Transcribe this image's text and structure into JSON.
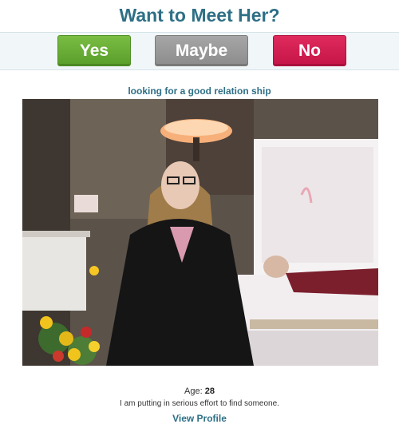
{
  "header": {
    "title": "Want to Meet Her?"
  },
  "actions": {
    "yes_label": "Yes",
    "maybe_label": "Maybe",
    "no_label": "No"
  },
  "profile": {
    "tagline": "looking for a good relation ship",
    "age_label": "Age:",
    "age_value": "28",
    "description": "I am putting in serious effort to find someone.",
    "view_profile_label": "View Profile"
  },
  "colors": {
    "title": "#2e6f86",
    "yes": "#6aad37",
    "maybe": "#999999",
    "no": "#d21f52",
    "bar_background": "#f1f7f9"
  }
}
